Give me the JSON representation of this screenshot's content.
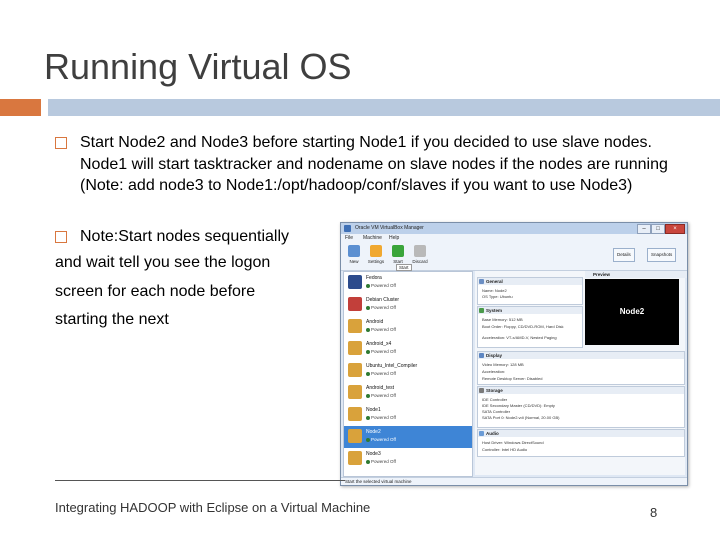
{
  "slide": {
    "title": "Running Virtual OS",
    "bullet1": "Start Node2 and Node3 before starting Node1 if you decided to use slave nodes. Node1 will start tasktracker and nodename on slave nodes if the nodes are running (Note: add node3 to Node1:/opt/hadoop/conf/slaves if you want to use Node3)",
    "bullet2": "Note:Start nodes sequentially",
    "cont1": "and wait tell you see the logon",
    "cont2": "screen for each node before",
    "cont3": "starting the next",
    "footer": "Integrating HADOOP with Eclipse on a Virtual Machine",
    "page_number": "8",
    "accent_color": "#d9773f",
    "bar_color": "#b8c9de"
  },
  "vbox": {
    "window_title": "Oracle VM VirtualBox Manager",
    "menu": [
      "File",
      "Machine",
      "Help"
    ],
    "toolbar": [
      "New",
      "Settings",
      "Start",
      "Discard"
    ],
    "tooltip": "Start",
    "right_buttons": [
      "Details",
      "Snapshots"
    ],
    "vms": [
      {
        "name": "Fedora",
        "state": "Powered Off",
        "color": "#2c4b8c"
      },
      {
        "name": "Debian Cluster",
        "state": "Powered Off",
        "color": "#c23f3a"
      },
      {
        "name": "Android",
        "state": "Powered Off",
        "color": "#d9a23b"
      },
      {
        "name": "Android_x4",
        "state": "Powered Off",
        "color": "#d9a23b"
      },
      {
        "name": "Ubuntu_Intel_Compiler",
        "state": "Powered Off",
        "color": "#d9a23b"
      },
      {
        "name": "Android_test",
        "state": "Powered Off",
        "color": "#d9a23b"
      },
      {
        "name": "Node1",
        "state": "Powered Off",
        "color": "#d9a23b"
      },
      {
        "name": "Node2",
        "state": "Powered Off",
        "color": "#d9a23b"
      },
      {
        "name": "Node3",
        "state": "Powered Off",
        "color": "#d9a23b"
      }
    ],
    "general": {
      "header": "General",
      "name": "Name:     Node2",
      "os": "OS Type:  Ubuntu"
    },
    "system": {
      "header": "System",
      "memory": "Base Memory:  512 MB",
      "boot": "Boot Order:  Floppy, CD/DVD-ROM, Hard Disk",
      "accel": "Acceleration:  VT-x/AMD-V, Nested Paging"
    },
    "display": {
      "header": "Display",
      "vmem": "Video Memory:  128 MB",
      "accel": "Acceleration:",
      "rdp": "Remote Desktop Server:  Disabled"
    },
    "storage": {
      "header": "Storage",
      "ide": "IDE Controller",
      "ide_dev": "  IDE Secondary Master (CD/DVD):  Empty",
      "sata": "SATA Controller",
      "sata_port": "  SATA Port 0:           Node2.vdi (Normal, 20.00 GB)"
    },
    "audio": {
      "header": "Audio",
      "host": "Host Driver:  Windows DirectSound",
      "ctrl": "Controller:  Intel HD Audio"
    },
    "preview": {
      "header": "Preview",
      "label": "Node2"
    },
    "status": "Start the selected virtual machine"
  }
}
